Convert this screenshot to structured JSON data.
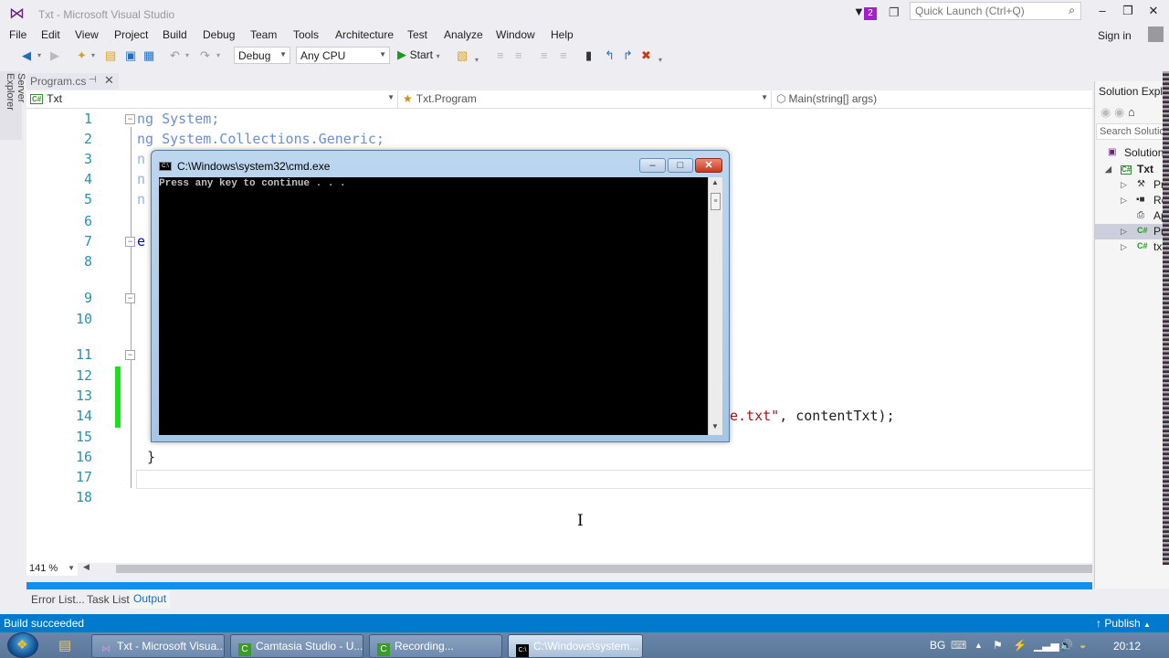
{
  "window": {
    "title": "Txt - Microsoft Visual Studio",
    "notification_count": "2",
    "quick_launch_placeholder": "Quick Launch (Ctrl+Q)",
    "sign_in": "Sign in",
    "min_glyph": "‒",
    "restore_glyph": "❐",
    "close_glyph": "✕"
  },
  "menu": [
    "File",
    "Edit",
    "View",
    "Project",
    "Build",
    "Debug",
    "Team",
    "Tools",
    "Architecture",
    "Test",
    "Analyze",
    "Window",
    "Help"
  ],
  "toolbar": {
    "config": "Debug",
    "platform": "Any CPU",
    "start_label": "Start"
  },
  "side_tabs": {
    "server_explorer": "Server Explorer"
  },
  "doc_tab": {
    "label": "Program.cs",
    "pin": "⊣",
    "close": "✕"
  },
  "navbar": {
    "project": "Txt",
    "class": "Txt.Program",
    "member": "Main(string[] args)"
  },
  "editor": {
    "line_numbers": [
      "1",
      "2",
      "3",
      "4",
      "5",
      "6",
      "7",
      "8",
      "9",
      "10",
      "11",
      "12",
      "13",
      "14",
      "15",
      "16",
      "17",
      "18"
    ],
    "lines": [
      {
        "n": 1,
        "text": "ng System;"
      },
      {
        "n": 2,
        "text": "ng System.Collections.Generic;"
      },
      {
        "n": 3,
        "text": "n"
      },
      {
        "n": 4,
        "text": "n"
      },
      {
        "n": 5,
        "text": "n"
      },
      {
        "n": 7,
        "text": "e"
      },
      {
        "n": 14,
        "text_string": "e.txt\"",
        "text_rest": ", contentTxt);"
      },
      {
        "n": 16,
        "text": "}"
      }
    ],
    "zoom_level": "141 %"
  },
  "cmd_window": {
    "title": "C:\\Windows\\system32\\cmd.exe",
    "output": "Press any key to continue . . .",
    "min": "–",
    "max": "□",
    "close": "✕"
  },
  "solution_explorer": {
    "title": "Solution Explorer",
    "search_placeholder": "Search Solution Explorer",
    "items": [
      {
        "label": "Solution 'Txt'",
        "icon": "solution-icon"
      },
      {
        "label": "Txt",
        "icon": "csharp-project-icon"
      },
      {
        "label": "Properties",
        "icon": "wrench-icon"
      },
      {
        "label": "References",
        "icon": "references-icon"
      },
      {
        "label": "App.config",
        "icon": "config-file-icon"
      },
      {
        "label": "Program.cs",
        "icon": "csharp-file-icon",
        "selected": true
      },
      {
        "label": "txt",
        "icon": "csharp-file-icon"
      }
    ]
  },
  "bottom_tabs": [
    "Error List...",
    "Task List",
    "Output"
  ],
  "status": {
    "text": "Build succeeded",
    "publish": "Publish"
  },
  "taskbar": {
    "buttons": [
      {
        "label": "Txt - Microsoft Visua...",
        "icon": "visual-studio-icon"
      },
      {
        "label": "Camtasia Studio - U...",
        "icon": "camtasia-icon"
      },
      {
        "label": "Recording...",
        "icon": "camtasia-recorder-icon"
      },
      {
        "label": "C:\\Windows\\system...",
        "icon": "cmd-icon",
        "active": true
      }
    ],
    "language": "BG",
    "clock": "20:12"
  },
  "colors": {
    "accent": "#007acc",
    "line_number": "#2b91af",
    "string": "#a31515",
    "keyword": "#0000ff",
    "change_bar": "#1be01b"
  }
}
